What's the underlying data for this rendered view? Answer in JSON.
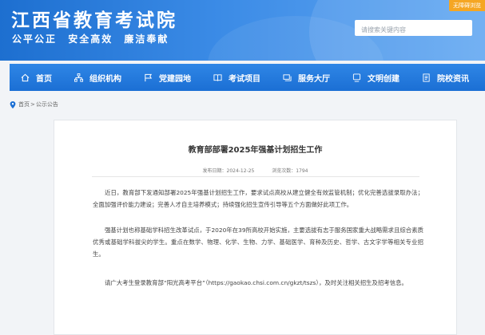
{
  "header": {
    "site_title": "江西省教育考试院",
    "slogan": [
      "公平公正",
      "安全高效",
      "廉洁奉献"
    ],
    "accessibility_label": "无障碍浏览",
    "search_placeholder": "请搜索关键内容"
  },
  "nav": {
    "items": [
      {
        "label": "首页",
        "icon": "home-icon"
      },
      {
        "label": "组织机构",
        "icon": "org-chart-icon"
      },
      {
        "label": "党建园地",
        "icon": "flag-icon"
      },
      {
        "label": "考试项目",
        "icon": "book-icon"
      },
      {
        "label": "服务大厅",
        "icon": "service-icon"
      },
      {
        "label": "文明创建",
        "icon": "monitor-icon"
      },
      {
        "label": "院校资讯",
        "icon": "document-icon"
      }
    ]
  },
  "breadcrumb": {
    "home": "首页",
    "separator": ">",
    "current": "公示公告"
  },
  "article": {
    "title": "教育部部署2025年强基计划招生工作",
    "publish_label": "发布日期：",
    "publish_date": "2024-12-25",
    "views_label": "浏览次数：",
    "views": "1794",
    "paragraphs": [
      "近日，教育部下发通知部署2025年强基计划招生工作，要求试点高校从建立健全有效监管机制；优化完善选拔录取办法；全面加强评价能力建设；完善人才自主培养模式；持续强化招生宣传引导等五个方面做好此项工作。",
      "强基计划也称基础学科招生改革试点，于2020年在39所高校开始实施，主要选拔有志于服务国家重大战略需求且综合素质优秀或基础学科拔尖的学生。重点在数学、物理、化学、生物、力学、基础医学、育种及历史、哲学、古文字学等相关专业招生。",
      "请广大考生登录教育部“阳光高考平台”（https://gaokao.chsi.com.cn/gkzt/tszs），及时关注相关招生及招考信息。"
    ]
  },
  "colors": {
    "header_blue": "#1d6fd0",
    "nav_blue": "#1b6fd4",
    "accessibility_orange": "#f5a623",
    "page_bg": "#f2f4f7"
  }
}
